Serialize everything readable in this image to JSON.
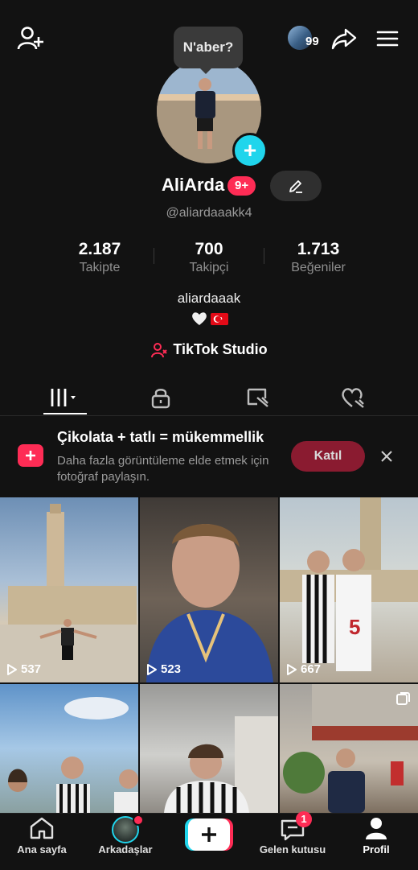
{
  "header": {
    "follow_count_badge": "99"
  },
  "bubble": {
    "text": "N'aber?"
  },
  "profile": {
    "name": "AliArda",
    "badge": "9+",
    "handle": "@aliardaaakk4",
    "bio": "aliardaaak",
    "studio_label": "TikTok Studio"
  },
  "stats": [
    {
      "value": "2.187",
      "label": "Takipte"
    },
    {
      "value": "700",
      "label": "Takipçi"
    },
    {
      "value": "1.713",
      "label": "Beğeniler"
    }
  ],
  "tabs": [
    {
      "icon": "grid-icon",
      "active": true
    },
    {
      "icon": "lock-icon",
      "active": false
    },
    {
      "icon": "tagged-icon",
      "active": false
    },
    {
      "icon": "liked-heart-icon",
      "active": false
    }
  ],
  "promo": {
    "title": "Çikolata + tatlı = mükemmellik",
    "description": "Daha fazla görüntüleme elde etmek için fotoğraf paylaşın.",
    "join_label": "Katıl"
  },
  "videos": [
    {
      "views": "537"
    },
    {
      "views": "523"
    },
    {
      "views": "667"
    },
    {
      "views": ""
    },
    {
      "views": ""
    },
    {
      "views": ""
    }
  ],
  "nav": {
    "home": "Ana sayfa",
    "friends": "Arkadaşlar",
    "inbox": "Gelen kutusu",
    "inbox_badge": "1",
    "profile": "Profil"
  },
  "colors": {
    "accent": "#fe2c55",
    "cyan": "#20d5ec",
    "background": "#121212"
  }
}
